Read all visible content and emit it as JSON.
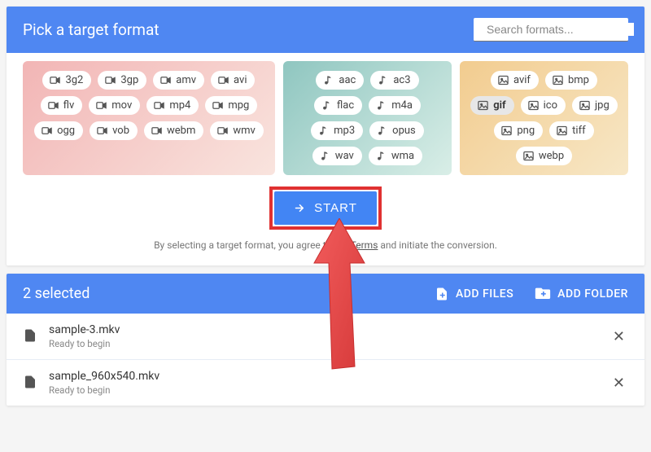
{
  "picker": {
    "title": "Pick a target format",
    "search_placeholder": "Search formats...",
    "video_formats": [
      "3g2",
      "3gp",
      "amv",
      "avi",
      "flv",
      "mov",
      "mp4",
      "mpg",
      "ogg",
      "vob",
      "webm",
      "wmv"
    ],
    "audio_formats": [
      "aac",
      "ac3",
      "flac",
      "m4a",
      "mp3",
      "opus",
      "wav",
      "wma"
    ],
    "image_formats": [
      "avif",
      "bmp",
      "gif",
      "ico",
      "jpg",
      "png",
      "tiff",
      "webp"
    ],
    "selected_format": "gif",
    "start_label": "START",
    "terms_prefix": "By selecting a target format, you agree to our ",
    "terms_link": "Terms",
    "terms_suffix": " and initiate the conversion."
  },
  "queue": {
    "selected_label": "2 selected",
    "add_files_label": "ADD FILES",
    "add_folder_label": "ADD FOLDER",
    "files": [
      {
        "name": "sample-3.mkv",
        "status": "Ready to begin"
      },
      {
        "name": "sample_960x540.mkv",
        "status": "Ready to begin"
      }
    ]
  }
}
